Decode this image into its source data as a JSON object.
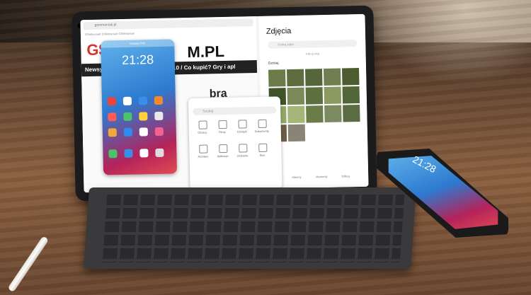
{
  "browser": {
    "url": "gsmmaniak.pl",
    "tabs": "GSMmaniaK   GSMmaniaK   GSMmaniaK",
    "logo_left": "GS",
    "logo_right": "M.PL",
    "nav_left": "Newsy",
    "nav_right": "ing  TOP-10 / Co kupić?  Gry i apl",
    "headline": "bra",
    "red_mark": "z"
  },
  "floating_window": {
    "top_label": "Huawei P40",
    "time": "21:28"
  },
  "gallery": {
    "title": "Zdjęcia",
    "search_placeholder": "Szukaj zdjęć",
    "subtitle": "Kliknij tutaj",
    "date_label": "Dzisiaj",
    "tabs": [
      "Zdjęcia",
      "Albumy",
      "Momenty",
      "Odkryj"
    ]
  },
  "search_window": {
    "placeholder": "Szukaj",
    "items": [
      {
        "label": "Obrazy"
      },
      {
        "label": "Filmy"
      },
      {
        "label": "Dźwięki"
      },
      {
        "label": "Dokumenty"
      },
      {
        "label": "Archiwa"
      },
      {
        "label": "Aplikacje"
      },
      {
        "label": "Ulubione"
      },
      {
        "label": "Sieć"
      }
    ]
  },
  "phone": {
    "time": "21:28"
  }
}
